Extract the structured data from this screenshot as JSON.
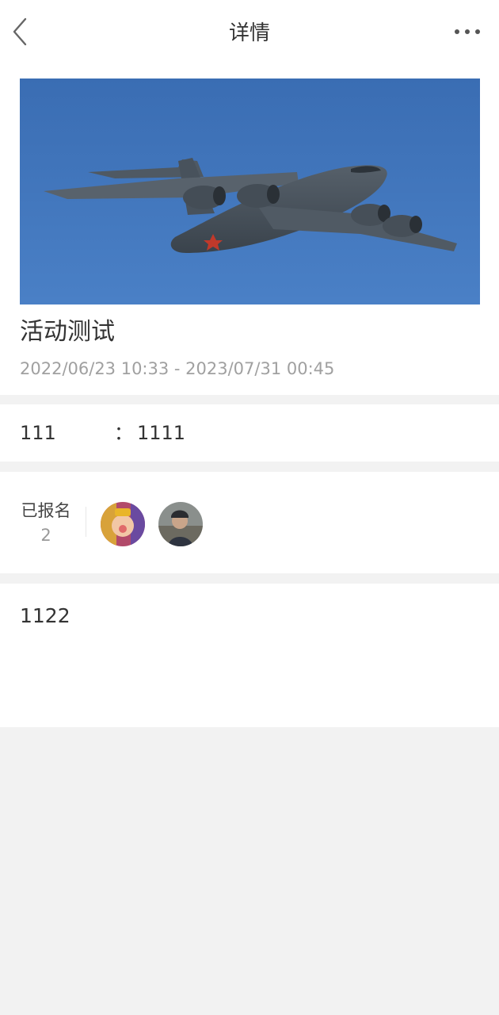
{
  "header": {
    "title": "详情",
    "back_icon": "chevron-left-icon",
    "more_icon": "more-dots-icon"
  },
  "event": {
    "title": "活动测试",
    "time_range": "2022/06/23 10:33 - 2023/07/31 00:45",
    "cover_image": "transport-aircraft-photo"
  },
  "field": {
    "label": "111",
    "separator": "：",
    "value": "1111"
  },
  "signup": {
    "label": "已报名",
    "count": "2",
    "avatars": [
      "participant-avatar-1",
      "participant-avatar-2"
    ]
  },
  "description": {
    "text": "1122"
  },
  "colors": {
    "background": "#f2f2f2",
    "card": "#ffffff",
    "text": "#333333",
    "muted_text": "#a0a0a0",
    "sky": "#3f72b6"
  }
}
